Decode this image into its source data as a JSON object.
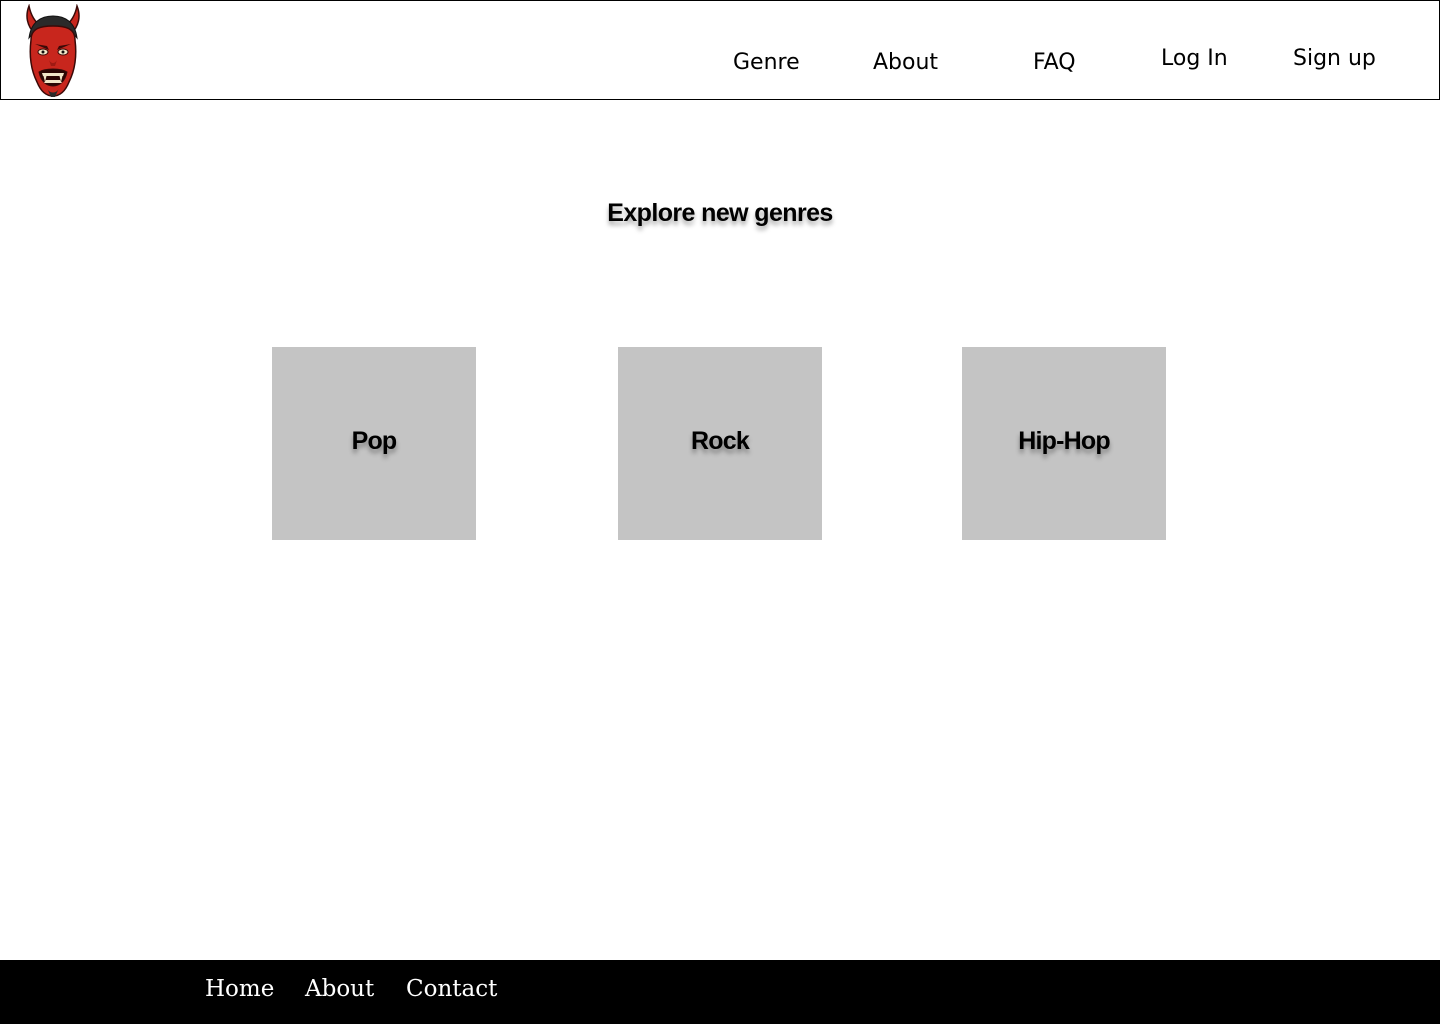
{
  "header": {
    "logo_icon": "oni-demon-mask-icon",
    "nav": {
      "genre": "Genre",
      "about": "About",
      "faq": "FAQ",
      "login": "Log In",
      "signup": "Sign up"
    }
  },
  "main": {
    "title": "Explore new genres",
    "genres": [
      "Pop",
      "Rock",
      "Hip-Hop"
    ]
  },
  "footer": {
    "links": [
      "Home",
      "About",
      "Contact"
    ]
  },
  "colors": {
    "card_background": "#c4c4c4",
    "footer_background": "#000000",
    "mask_red": "#c8261d"
  }
}
